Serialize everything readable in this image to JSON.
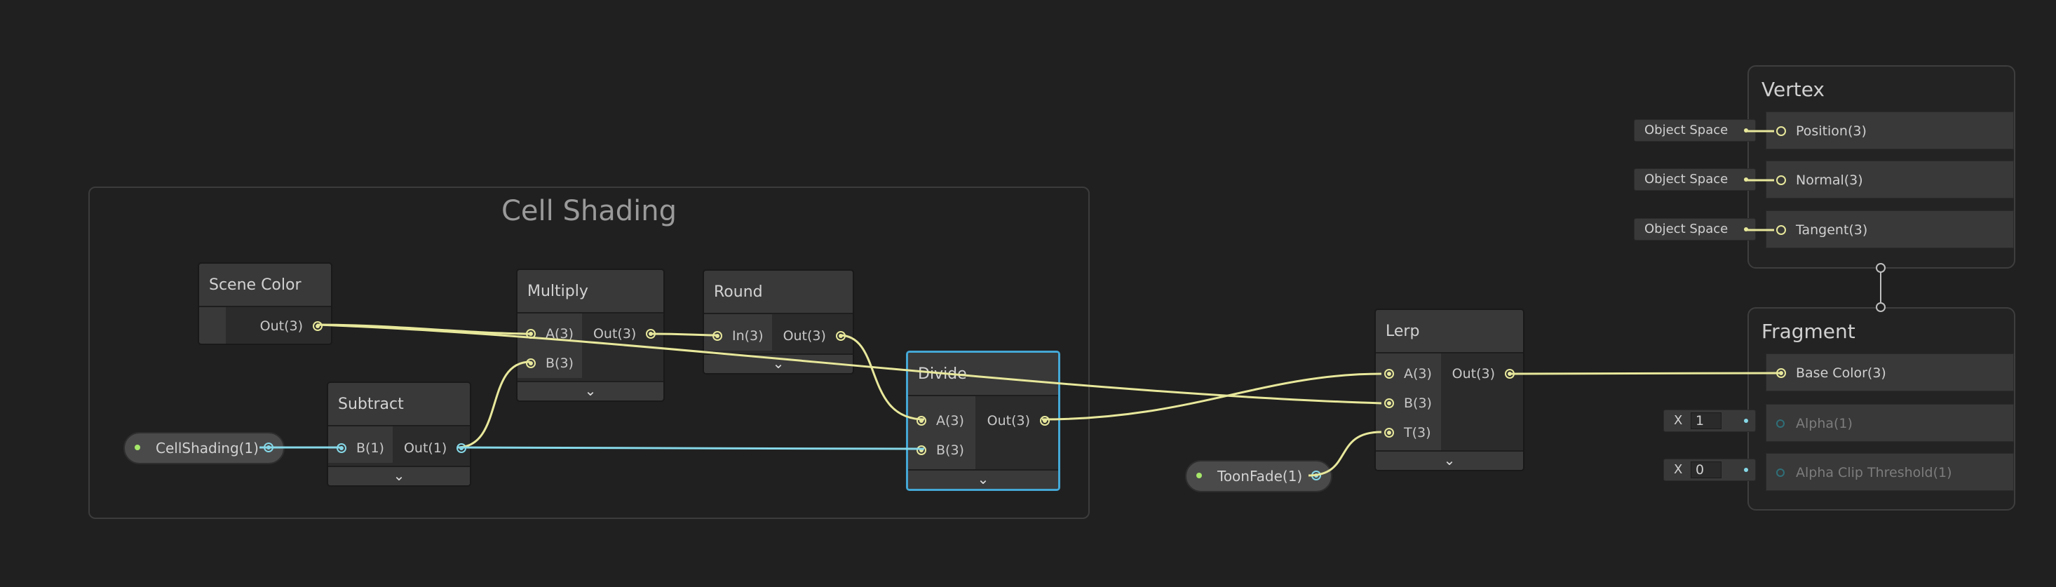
{
  "group": {
    "title": "Cell Shading"
  },
  "nodes": {
    "scene_color": {
      "title": "Scene Color",
      "outputs": [
        "Out(3)"
      ]
    },
    "multiply": {
      "title": "Multiply",
      "inputs": [
        "A(3)",
        "B(3)"
      ],
      "outputs": [
        "Out(3)"
      ]
    },
    "round": {
      "title": "Round",
      "inputs": [
        "In(3)"
      ],
      "outputs": [
        "Out(3)"
      ]
    },
    "subtract": {
      "title": "Subtract",
      "inputs": [
        "B(1)"
      ],
      "outputs": [
        "Out(1)"
      ]
    },
    "divide": {
      "title": "Divide",
      "inputs": [
        "A(3)",
        "B(3)"
      ],
      "outputs": [
        "Out(3)"
      ]
    },
    "lerp": {
      "title": "Lerp",
      "inputs": [
        "A(3)",
        "B(3)",
        "T(3)"
      ],
      "outputs": [
        "Out(3)"
      ]
    }
  },
  "properties": {
    "cell_shading": "CellShading(1)",
    "toon_fade": "ToonFade(1)"
  },
  "vertex": {
    "title": "Vertex",
    "slots": [
      "Position(3)",
      "Normal(3)",
      "Tangent(3)"
    ],
    "space_labels": [
      "Object Space",
      "Object Space",
      "Object Space"
    ]
  },
  "fragment": {
    "title": "Fragment",
    "slots": [
      "Base Color(3)",
      "Alpha(1)",
      "Alpha Clip Threshold(1)"
    ],
    "alpha_field": {
      "axis": "X",
      "value": "1"
    },
    "clip_field": {
      "axis": "X",
      "value": "0"
    }
  },
  "colors": {
    "wire_vec3": "#e8e89c",
    "wire_vec1": "#86d8e8",
    "selection": "#44a8d6",
    "property_dot": "#a6e86a"
  },
  "icons": {
    "expander": "chevron-down-icon"
  },
  "glyphs": {
    "chevron": "⌄"
  }
}
